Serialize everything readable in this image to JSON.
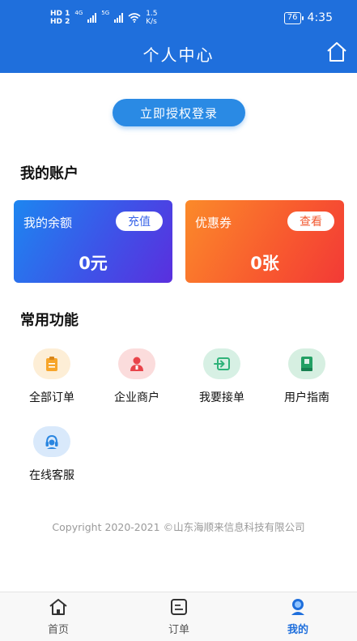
{
  "status_bar": {
    "network_left": "HD 1",
    "network_left2": "HD 2",
    "cell1": "4G",
    "cell2": "5G",
    "speed": "1.5",
    "speed_unit": "K/s",
    "battery": "76",
    "time": "4:35"
  },
  "header": {
    "title": "个人中心"
  },
  "login": {
    "label": "立即授权登录"
  },
  "account": {
    "section_title": "我的账户",
    "balance": {
      "label": "我的余额",
      "action": "充值",
      "value": "0元"
    },
    "coupon": {
      "label": "优惠券",
      "action": "查看",
      "value": "0张"
    }
  },
  "functions": {
    "section_title": "常用功能",
    "items": [
      {
        "label": "全部订单",
        "icon": "clipboard-icon",
        "color": "#f7a52a"
      },
      {
        "label": "企业商户",
        "icon": "merchant-icon",
        "color": "#e8444a"
      },
      {
        "label": "我要接单",
        "icon": "accept-order-icon",
        "color": "#2fb37a"
      },
      {
        "label": "用户指南",
        "icon": "book-icon",
        "color": "#23a064"
      },
      {
        "label": "在线客服",
        "icon": "headset-icon",
        "color": "#2a86e0"
      }
    ]
  },
  "footer": {
    "copyright": "Copyright 2020-2021 ©山东海顺来信息科技有限公司"
  },
  "tabbar": {
    "tabs": [
      {
        "label": "首页",
        "icon": "home-icon"
      },
      {
        "label": "订单",
        "icon": "order-icon"
      },
      {
        "label": "我的",
        "icon": "profile-icon",
        "active": true
      }
    ]
  },
  "colors": {
    "primary": "#1f6fdc",
    "balance_gradient_start": "#1d86f0",
    "coupon_gradient_start": "#fb8a2a"
  }
}
